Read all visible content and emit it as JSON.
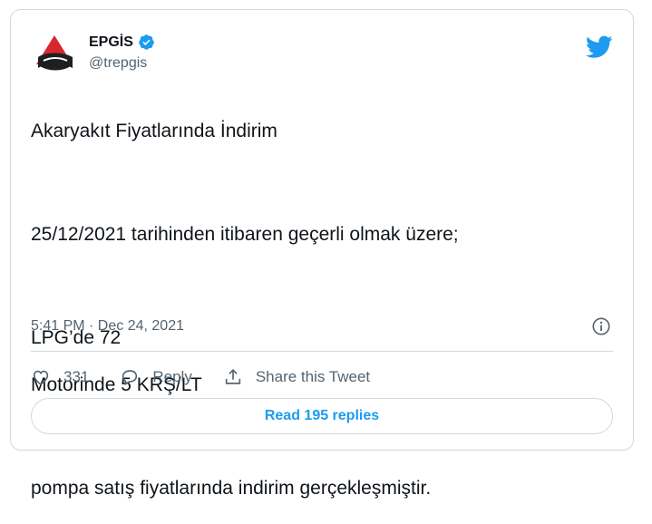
{
  "user": {
    "name": "EPGİS",
    "handle": "@trepgis",
    "verified": true
  },
  "tweet": {
    "line1": "Akaryakıt Fiyatlarında İndirim",
    "line2": "25/12/2021 tarihinden itibaren geçerli olmak üzere;",
    "line3": "LPG’de 72",
    "line4": "Motorinde 5 KRŞ/LT",
    "line5": "pompa satış fiyatlarında indirim gerçekleşmiştir.",
    "timestamp": "5:41 PM · Dec 24, 2021"
  },
  "actions": {
    "like_count": "331",
    "reply_label": "Reply",
    "share_label": "Share this Tweet"
  },
  "read_replies_label": "Read 195 replies",
  "colors": {
    "accent": "#1d9bf0",
    "secondary_text": "#536471",
    "border": "#cfd9de"
  },
  "icons": [
    "epgis-logo-avatar",
    "verified-badge-icon",
    "twitter-bird-icon",
    "info-icon",
    "heart-icon",
    "reply-bubble-icon",
    "share-icon"
  ]
}
